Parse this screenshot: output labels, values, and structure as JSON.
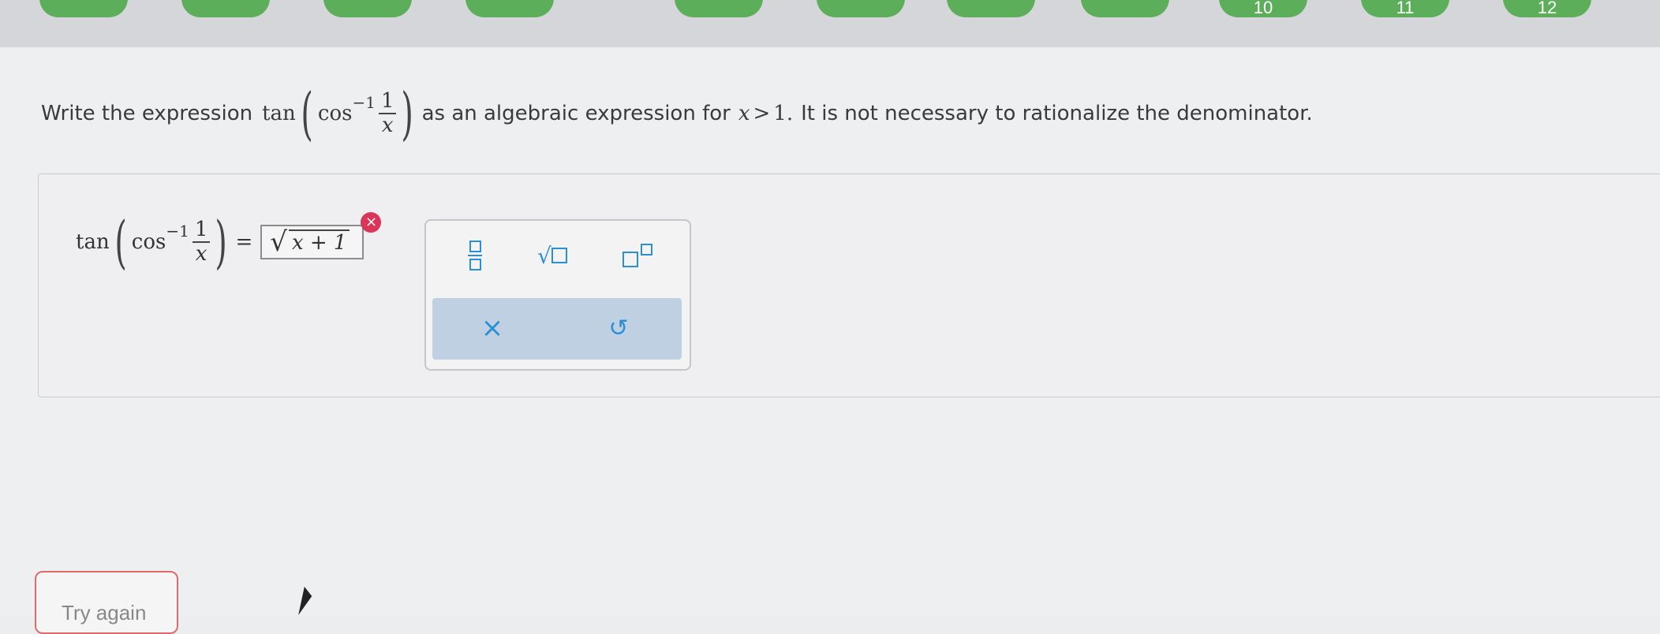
{
  "nav": {
    "pill_labels": [
      "",
      "",
      "",
      "",
      "",
      "",
      "",
      "",
      "10",
      "11",
      "12"
    ]
  },
  "question": {
    "prefix": "Write the expression",
    "func": "tan",
    "inner_func": "cos",
    "exponent": "−1",
    "frac_num": "1",
    "frac_den": "x",
    "middle": "as an algebraic expression for",
    "condition_var": "x",
    "condition_op": ">",
    "condition_val": "1.",
    "suffix": "It is not necessary to rationalize the denominator."
  },
  "answer": {
    "func": "tan",
    "inner_func": "cos",
    "exponent": "−1",
    "frac_num": "1",
    "frac_den": "x",
    "equals": "=",
    "radicand": "x + 1",
    "error_icon": "error-x-icon"
  },
  "palette": {
    "buttons": [
      "fraction-icon",
      "sqrt-icon",
      "exponent-icon"
    ],
    "clear_symbol": "×",
    "undo_symbol": "↺"
  },
  "actions": {
    "try_again_label": "Try again"
  },
  "colors": {
    "accent": "#2a8fd6",
    "nav_green": "#5cae5a",
    "error": "#d9365a",
    "palette_actions_bg": "#bfd0e2"
  }
}
